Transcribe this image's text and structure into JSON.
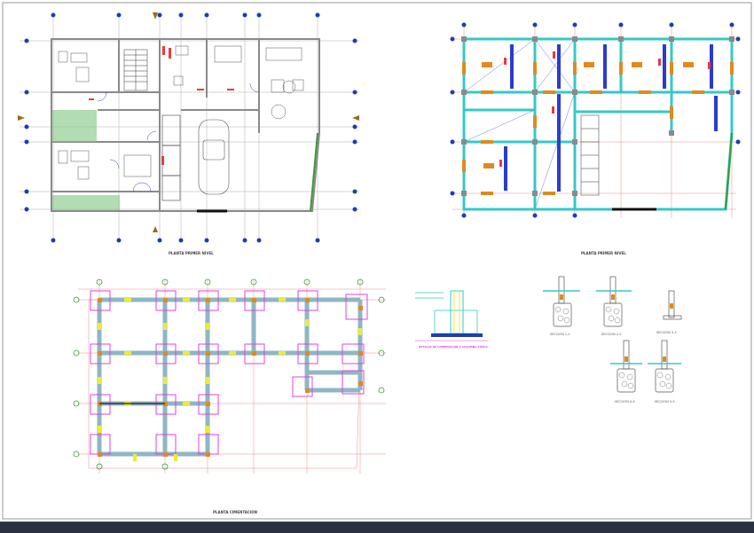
{
  "sheet": {
    "background": "#ffffff",
    "border_color": "#9a9a9a"
  },
  "colors": {
    "grid": "#1e3cb4",
    "wall": "#8a8a8a",
    "cyan": "#35c8c8",
    "magenta": "#e040e0",
    "orange": "#e08a1e",
    "yellow": "#ecec32",
    "red": "#e83a3a",
    "green": "#3a9a3a",
    "blue": "#2a3cd0",
    "dark": "#222222"
  },
  "drawings": {
    "floor_plan_title": "PLANTA PRIMER NIVEL",
    "structural_plan_title": "PLANTA PRIMER NIVEL",
    "foundation_plan_title": "PLANTA CIMENTACION",
    "detail_title": "DETALLE DE CIMENTACION Y COLUMNA TIPICA",
    "sections": [
      {
        "label": "SECCION 1-1"
      },
      {
        "label": "SECCION 2-2"
      },
      {
        "label": "SECCION 3-3"
      },
      {
        "label": "SECCION 4-4"
      },
      {
        "label": "SECCION 5-5"
      }
    ]
  }
}
